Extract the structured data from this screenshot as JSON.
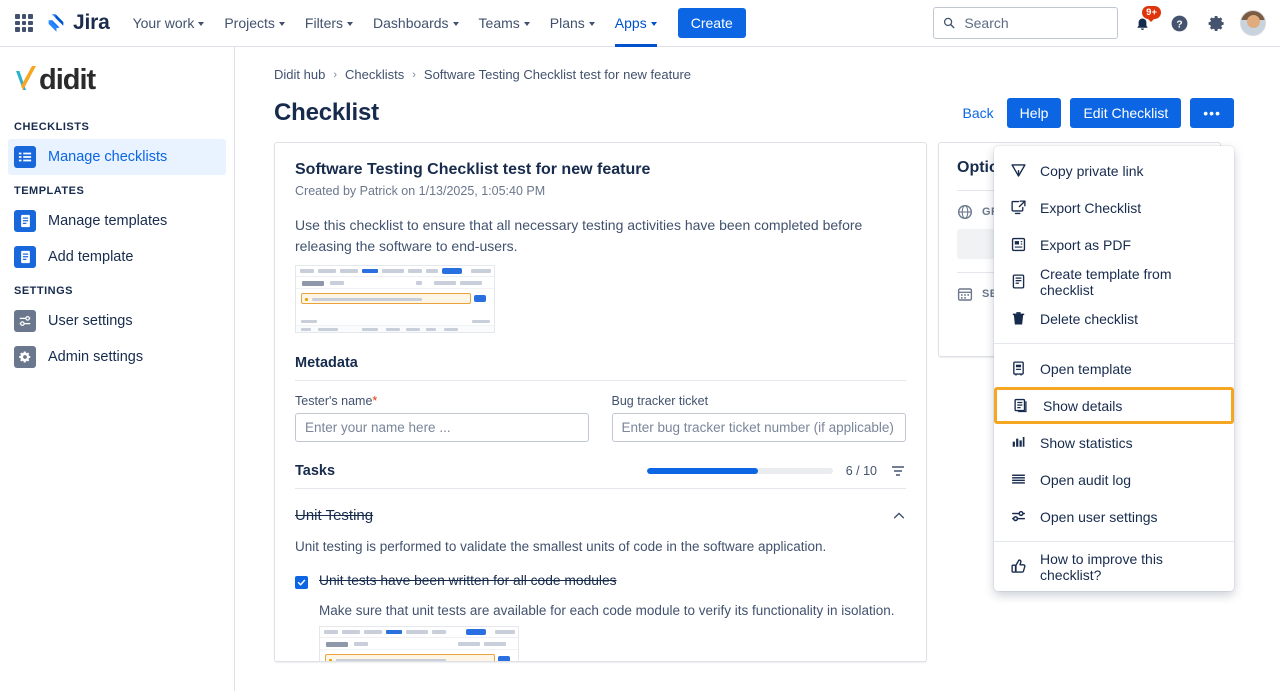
{
  "topnav": {
    "brand": "Jira",
    "app_switcher_icon": "grid-apps-icon",
    "items": [
      {
        "label": "Your work",
        "active": false
      },
      {
        "label": "Projects",
        "active": false
      },
      {
        "label": "Filters",
        "active": false
      },
      {
        "label": "Dashboards",
        "active": false
      },
      {
        "label": "Teams",
        "active": false
      },
      {
        "label": "Plans",
        "active": false
      },
      {
        "label": "Apps",
        "active": true
      }
    ],
    "create_label": "Create",
    "search_placeholder": "Search",
    "search_value": "",
    "notifications_badge": "9+",
    "help_icon": "help-circle-icon",
    "settings_icon": "gear-icon",
    "avatar_icon": "user-avatar"
  },
  "sidebar": {
    "logo": "didit",
    "sections": [
      {
        "label": "CHECKLISTS",
        "items": [
          {
            "label": "Manage checklists",
            "icon": "list-icon",
            "active": true,
            "tone": "blue"
          }
        ]
      },
      {
        "label": "TEMPLATES",
        "items": [
          {
            "label": "Manage templates",
            "icon": "document-icon",
            "active": false,
            "tone": "blue"
          },
          {
            "label": "Add template",
            "icon": "document-icon",
            "active": false,
            "tone": "blue"
          }
        ]
      },
      {
        "label": "SETTINGS",
        "items": [
          {
            "label": "User settings",
            "icon": "sliders-icon",
            "active": false,
            "tone": "grey"
          },
          {
            "label": "Admin settings",
            "icon": "gear-icon",
            "active": false,
            "tone": "grey"
          }
        ]
      }
    ]
  },
  "breadcrumb": {
    "items": [
      "Didit hub",
      "Checklists",
      "Software Testing Checklist test for new feature"
    ],
    "separator": "›"
  },
  "page": {
    "title": "Checklist",
    "actions": {
      "back": "Back",
      "help": "Help",
      "edit_checklist": "Edit Checklist",
      "more": "•••"
    }
  },
  "checklist": {
    "title": "Software Testing Checklist test for new feature",
    "created_by": "Created by Patrick on 1/13/2025, 1:05:40 PM",
    "description": "Use this checklist to ensure that all necessary testing activities have been completed before releasing the software to end-users.",
    "metadata": {
      "heading": "Metadata",
      "fields": [
        {
          "label": "Tester's name",
          "required": true,
          "placeholder": "Enter your name here ...",
          "value": ""
        },
        {
          "label": "Bug tracker ticket",
          "required": false,
          "placeholder": "Enter bug tracker ticket number (if applicable) ...",
          "value": ""
        }
      ]
    },
    "tasks": {
      "heading": "Tasks",
      "progress_label": "6 / 10",
      "progress_completed": 6,
      "progress_total": 10,
      "progress_percent": 60,
      "filter_icon": "filter-icon",
      "groups": [
        {
          "title": "Unit Testing",
          "completed": true,
          "collapse_icon": "chevron-up-icon",
          "description": "Unit testing is performed to validate the smallest units of code in the software application.",
          "items": [
            {
              "label": "Unit tests have been written for all code modules",
              "checked": true,
              "note": "Make sure that unit tests are available for each code module to verify its functionality in isolation."
            }
          ]
        }
      ]
    }
  },
  "options_panel": {
    "title": "Options",
    "rows": [
      {
        "icon": "globe-icon",
        "label": "GR"
      },
      {
        "icon": "calendar-icon",
        "label": "SET"
      }
    ]
  },
  "dropdown_menu": {
    "highlight_color": "#f5a623",
    "groups": [
      {
        "items": [
          {
            "label": "Copy private link",
            "icon": "send-icon"
          },
          {
            "label": "Export Checklist",
            "icon": "export-icon"
          },
          {
            "label": "Export as PDF",
            "icon": "pdf-icon"
          },
          {
            "label": "Create template from checklist",
            "icon": "template-icon"
          },
          {
            "label": "Delete checklist",
            "icon": "trash-icon"
          }
        ]
      },
      {
        "items": [
          {
            "label": "Open template",
            "icon": "book-icon"
          },
          {
            "label": "Show details",
            "icon": "details-icon",
            "highlighted": true
          },
          {
            "label": "Show statistics",
            "icon": "bar-chart-icon"
          },
          {
            "label": "Open audit log",
            "icon": "lines-icon"
          },
          {
            "label": "Open user settings",
            "icon": "sliders-icon"
          }
        ]
      },
      {
        "items": [
          {
            "label": "How to improve this checklist?",
            "icon": "thumbs-up-icon"
          }
        ]
      }
    ]
  },
  "colors": {
    "primary_blue": "#0c66e4",
    "jira_navy": "#172b4d",
    "highlight_orange": "#f5a623",
    "badge_red": "#de350b",
    "border_grey": "#dfe1e6"
  }
}
